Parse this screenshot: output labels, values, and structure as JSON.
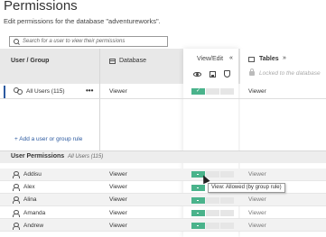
{
  "page": {
    "title": "Permissions",
    "subtitle": "Edit permissions for the database \"adventureworks\"."
  },
  "search": {
    "placeholder": "Search for a user to view their permissions"
  },
  "columns": {
    "user_group": "User / Group",
    "database": "Database",
    "view_edit": "View/Edit",
    "view_edit_toggle": "«",
    "tables": "Tables",
    "tables_toggle": "»",
    "locked_text": "Locked to the database"
  },
  "group_rules": [
    {
      "name": "All Users (115)",
      "more": "•••",
      "database": "Viewer",
      "capabilities": [
        "allowed",
        "none",
        "none"
      ],
      "tables": "Viewer"
    }
  ],
  "add_rule_label": "+ Add a user or group rule",
  "user_permissions": {
    "title": "User Permissions",
    "subtitle": "All Users (115)",
    "rows": [
      {
        "name": "Addisu",
        "database": "Viewer",
        "tables": "Viewer"
      },
      {
        "name": "Alex",
        "database": "Viewer",
        "tables": ""
      },
      {
        "name": "Alina",
        "database": "Viewer",
        "tables": "Viewer"
      },
      {
        "name": "Amanda",
        "database": "Viewer",
        "tables": "Viewer"
      },
      {
        "name": "Andrew",
        "database": "Viewer",
        "tables": "Viewer"
      }
    ]
  },
  "tooltip": "View: Allowed (by group rule)",
  "colors": {
    "allowed": "#4ab38b",
    "none": "#e6e6e6",
    "link": "#2c5aa0"
  },
  "icons": [
    "search-icon",
    "database-icon",
    "eye-icon",
    "save-icon",
    "shield-icon",
    "table-icon",
    "lock-icon",
    "group-icon",
    "user-icon",
    "more-icon"
  ]
}
